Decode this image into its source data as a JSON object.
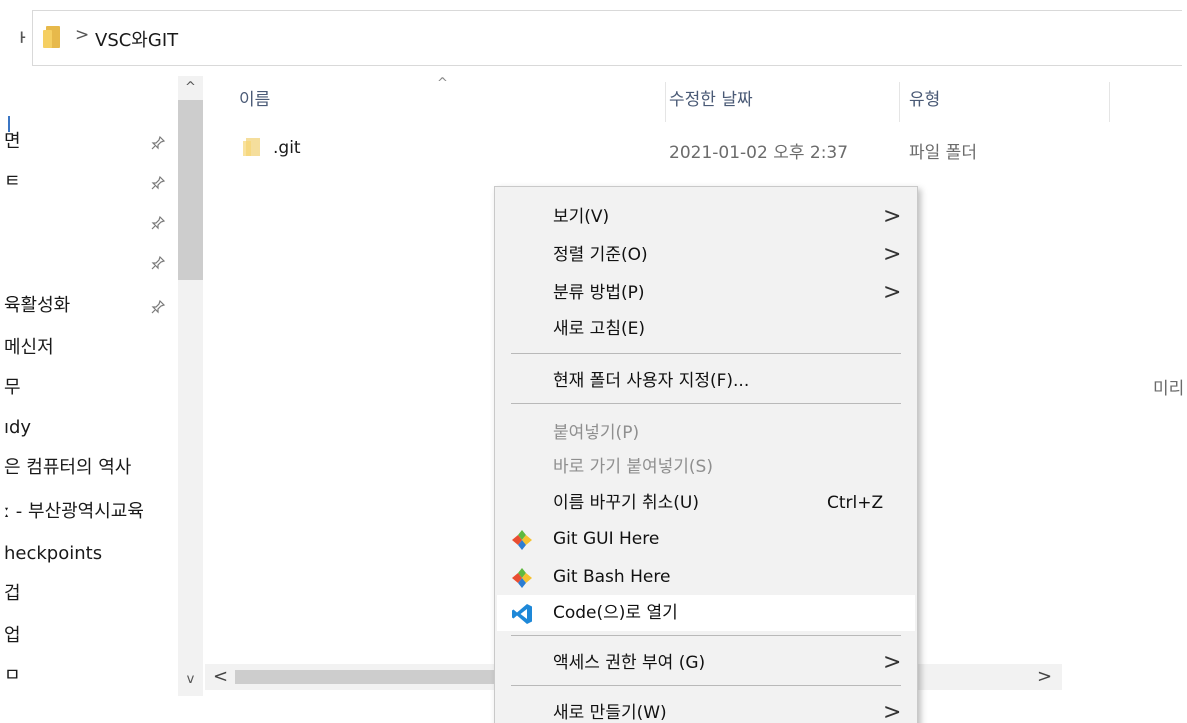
{
  "address": {
    "cutoff_glyph": "ᅡ",
    "separator": ">",
    "path": "VSC와GIT"
  },
  "nav": {
    "scroll_up": "^",
    "scroll_down": "v",
    "pin_glyph": "📌",
    "items": [
      {
        "label": "면",
        "pinned": true
      },
      {
        "label": "ㅌ",
        "pinned": true
      },
      {
        "label": "",
        "pinned": true
      },
      {
        "label": "",
        "pinned": true
      },
      {
        "label": "육활성화",
        "pinned": true
      },
      {
        "label": "메신저",
        "pinned": false
      },
      {
        "label": "무",
        "pinned": false
      },
      {
        "label": "ıdy",
        "pinned": false
      },
      {
        "label": "은 컴퓨터의 역사",
        "pinned": false
      },
      {
        "label": "ː - 부산광역시교육",
        "pinned": false
      },
      {
        "label": "heckpoints",
        "pinned": false
      },
      {
        "label": "겁",
        "pinned": false
      },
      {
        "label": "업",
        "pinned": false
      },
      {
        "label": "ㅁ",
        "pinned": false
      }
    ]
  },
  "filelist": {
    "sort_caret": "^",
    "columns": {
      "name": "이름",
      "date": "수정한 날짜",
      "type": "유형"
    },
    "rows": [
      {
        "name": ".git",
        "date": "2021-01-02 오후 2:37",
        "type": "파일 폴더"
      }
    ],
    "preview_text": "미리",
    "hscroll_left": "<",
    "hscroll_right": ">"
  },
  "context_menu": {
    "items": [
      {
        "label": "보기(V)",
        "submenu": true
      },
      {
        "label": "정렬 기준(O)",
        "submenu": true
      },
      {
        "label": "분류 방법(P)",
        "submenu": true
      },
      {
        "label": "새로 고침(E)"
      },
      {
        "label": "현재 폴더 사용자 지정(F)..."
      },
      {
        "label": "붙여넣기(P)",
        "disabled": true
      },
      {
        "label": "바로 가기 붙여넣기(S)",
        "disabled": true
      },
      {
        "label": "이름 바꾸기 취소(U)",
        "shortcut": "Ctrl+Z"
      },
      {
        "label": "Git GUI Here",
        "icon": "git-icon"
      },
      {
        "label": "Git Bash Here",
        "icon": "git-icon"
      },
      {
        "label": "Code(으)로 열기",
        "icon": "vscode-icon"
      },
      {
        "label": "액세스 권한 부여 (G)",
        "submenu": true
      },
      {
        "label": "새로 만들기(W)",
        "submenu": true
      }
    ],
    "arrow_glyph": ">"
  },
  "colors": {
    "git_red": "#e94e31",
    "git_green": "#5eb93f",
    "git_blue": "#2d7dd2",
    "git_yellow": "#f5c12f",
    "vscode_blue": "#1e88d8",
    "folder_yellow": "#f5cf62"
  }
}
